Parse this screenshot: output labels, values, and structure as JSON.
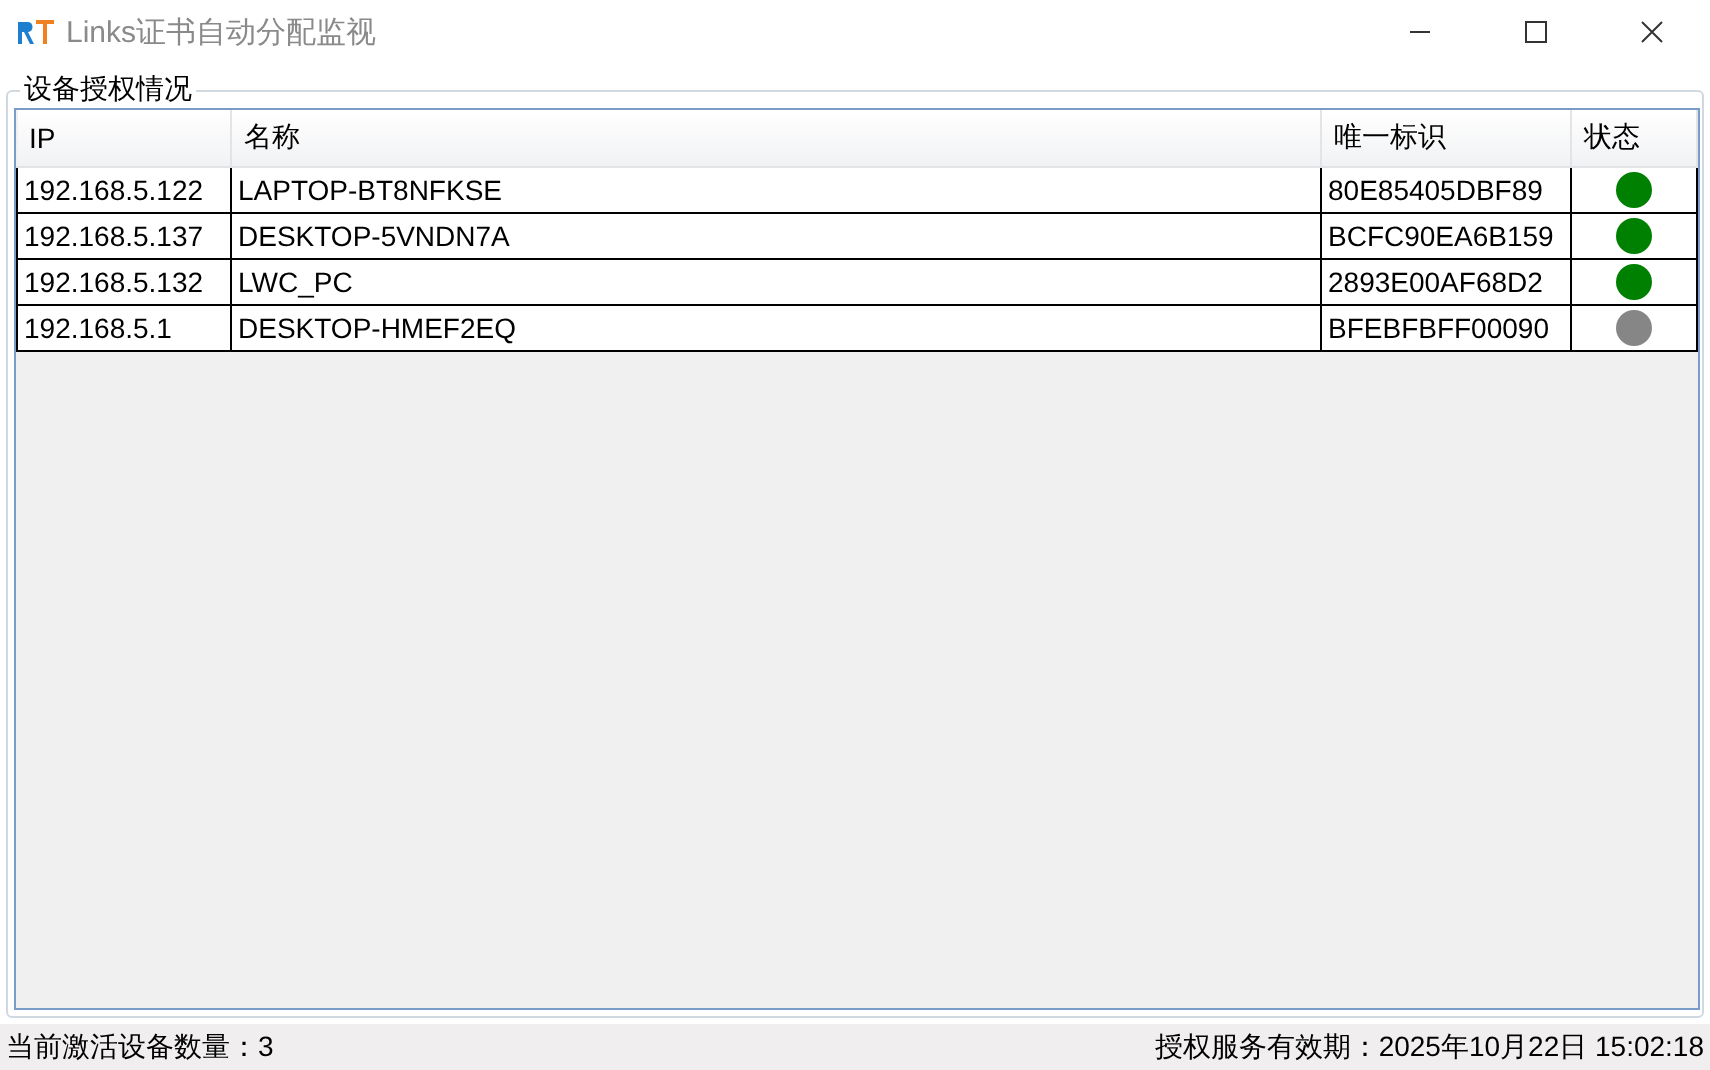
{
  "window": {
    "title": "Links证书自动分配监视"
  },
  "group": {
    "title": "设备授权情况"
  },
  "table": {
    "columns": [
      "IP",
      "名称",
      "唯一标识",
      "状态"
    ],
    "rows": [
      {
        "ip": "192.168.5.122",
        "name": "LAPTOP-BT8NFKSE",
        "id": "80E85405DBF89",
        "color": "#008000"
      },
      {
        "ip": "192.168.5.137",
        "name": "DESKTOP-5VNDN7A",
        "id": "BCFC90EA6B159",
        "color": "#008000"
      },
      {
        "ip": "192.168.5.132",
        "name": "LWC_PC",
        "id": "2893E00AF68D2",
        "color": "#008000"
      },
      {
        "ip": "192.168.5.1",
        "name": "DESKTOP-HMEF2EQ",
        "id": "BFEBFBFF00090",
        "color": "#868686"
      }
    ]
  },
  "status_bar": {
    "left": "当前激活设备数量：3",
    "right": "授权服务有效期：2025年10月22日 15:02:18"
  }
}
